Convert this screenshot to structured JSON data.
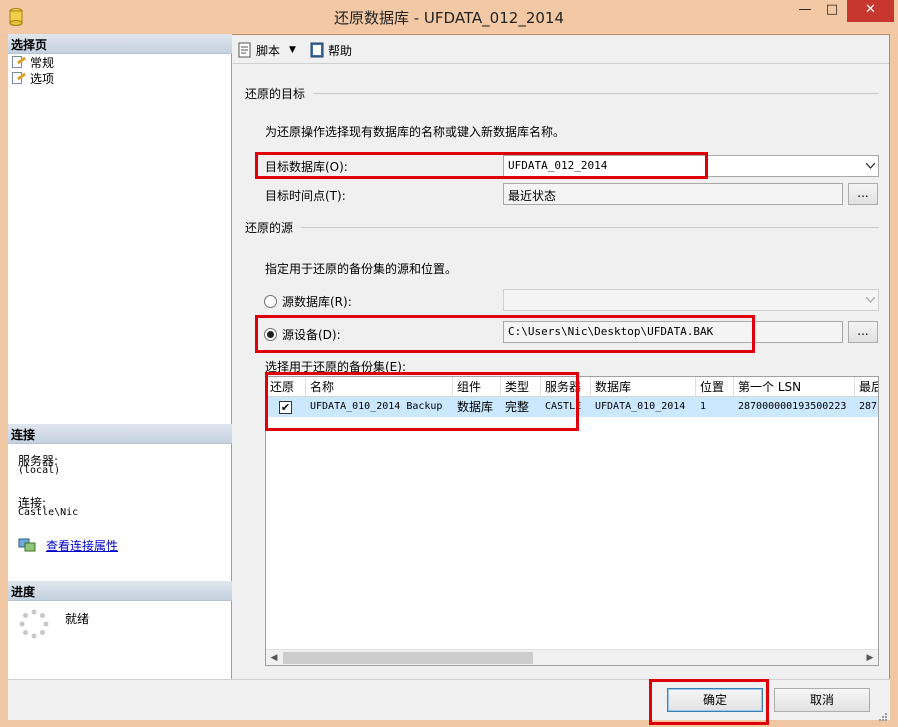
{
  "window": {
    "title": "还原数据库 - UFDATA_012_2014",
    "min_glyph": "—",
    "max_glyph": "□",
    "close_glyph": "✕"
  },
  "left_pane": {
    "select_page_header": "选择页",
    "pages": [
      {
        "label": "常规"
      },
      {
        "label": "选项"
      }
    ],
    "connection_header": "连接",
    "server_label": "服务器:",
    "server_value": "(local)",
    "connection_label": "连接:",
    "connection_value": "Castle\\Nic",
    "view_connection_link": "查看连接属性",
    "progress_header": "进度",
    "progress_status": "就绪"
  },
  "toolbar": {
    "script_label": "脚本",
    "help_label": "帮助"
  },
  "restore_target": {
    "section_title": "还原的目标",
    "instruction": "为还原操作选择现有数据库的名称或键入新数据库名称。",
    "to_database_label": "目标数据库(O):",
    "to_database_value": "UFDATA_012_2014",
    "to_point_label": "目标时间点(T):",
    "to_point_value": "最近状态",
    "ellipsis": "..."
  },
  "restore_source": {
    "section_title": "还原的源",
    "instruction": "指定用于还原的备份集的源和位置。",
    "from_database_label": "源数据库(R):",
    "from_device_label": "源设备(D):",
    "from_device_value": "C:\\Users\\Nic\\Desktop\\UFDATA.BAK",
    "ellipsis": "...",
    "selected_option": "from_device"
  },
  "backup_sets": {
    "label": "选择用于还原的备份集(E):",
    "columns": [
      "还原",
      "名称",
      "组件",
      "类型",
      "服务器",
      "数据库",
      "位置",
      "第一个 LSN",
      "最后"
    ],
    "rows": [
      {
        "restore": true,
        "name": "UFDATA_010_2014 Backup",
        "component": "数据库",
        "type": "完整",
        "server": "CASTLE",
        "database": "UFDATA_010_2014",
        "position": "1",
        "first_lsn": "287000000193500223",
        "last_lsn": "287"
      }
    ]
  },
  "buttons": {
    "ok": "确定",
    "cancel": "取消"
  },
  "colors": {
    "highlight": "#e0000a",
    "selected_row": "#cce8ff",
    "title_bar": "#f3c9a5",
    "close_button": "#c7372f"
  }
}
